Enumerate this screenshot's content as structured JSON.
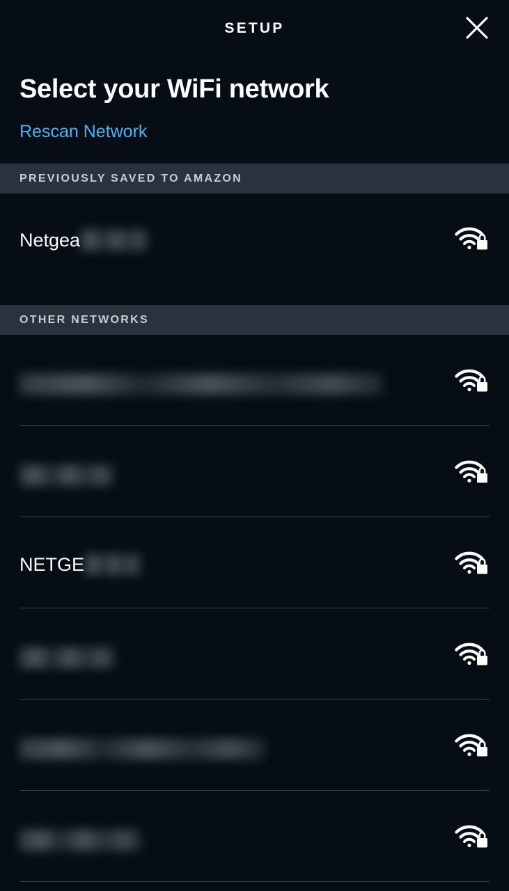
{
  "header": {
    "title": "SETUP",
    "close_icon": "close-icon"
  },
  "content": {
    "page_title": "Select your WiFi network",
    "rescan_link": "Rescan Network"
  },
  "sections": [
    {
      "id": "previously-saved",
      "label": "PREVIOUSLY SAVED TO AMAZON",
      "networks": [
        {
          "name_visible": "Netgea",
          "redacted": true,
          "redacted_width": 98,
          "secured": true,
          "icon": "wifi-lock-icon",
          "signal": 3
        }
      ]
    },
    {
      "id": "other-networks",
      "label": "OTHER NETWORKS",
      "networks": [
        {
          "name_visible": "",
          "redacted": true,
          "redacted_width": 522,
          "secured": true,
          "icon": "wifi-lock-icon",
          "signal": 3
        },
        {
          "name_visible": "",
          "redacted": true,
          "redacted_width": 136,
          "secured": true,
          "icon": "wifi-lock-icon",
          "signal": 3
        },
        {
          "name_visible": "NETGE",
          "redacted": true,
          "redacted_width": 82,
          "secured": true,
          "icon": "wifi-lock-icon",
          "signal": 3
        },
        {
          "name_visible": "",
          "redacted": true,
          "redacted_width": 138,
          "secured": true,
          "icon": "wifi-lock-icon",
          "signal": 3
        },
        {
          "name_visible": "",
          "redacted": true,
          "redacted_width": 352,
          "secured": true,
          "icon": "wifi-lock-icon",
          "signal": 3
        },
        {
          "name_visible": "",
          "redacted": true,
          "redacted_width": 175,
          "secured": true,
          "icon": "wifi-lock-icon",
          "signal": 3
        }
      ]
    }
  ],
  "colors": {
    "background": "#070d14",
    "section_band": "#2b323d",
    "section_label": "#c9ced6",
    "link": "#4db2f0",
    "text_primary": "#ffffff",
    "divider": "#39404b",
    "icon": "#ffffff"
  }
}
